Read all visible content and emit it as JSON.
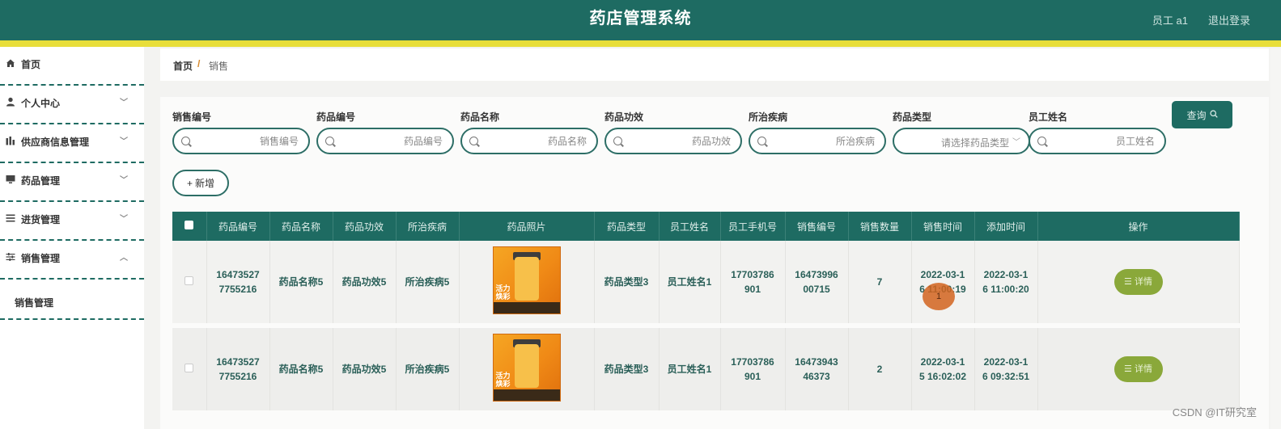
{
  "header": {
    "title": "药店管理系统",
    "user": "员工 a1",
    "logout": "退出登录"
  },
  "sidebar": {
    "items": [
      {
        "label": "首页",
        "icon": "home-icon"
      },
      {
        "label": "个人中心",
        "icon": "user-icon"
      },
      {
        "label": "供应商信息管理",
        "icon": "chart-icon"
      },
      {
        "label": "药品管理",
        "icon": "monitor-icon"
      },
      {
        "label": "进货管理",
        "icon": "list-icon"
      },
      {
        "label": "销售管理",
        "icon": "sliders-icon"
      }
    ],
    "sub_item": "销售管理"
  },
  "breadcrumb": {
    "home": "首页",
    "separator": "/",
    "current": "销售"
  },
  "search": {
    "fields": [
      {
        "label": "销售编号",
        "placeholder": "销售编号"
      },
      {
        "label": "药品编号",
        "placeholder": "药品编号"
      },
      {
        "label": "药品名称",
        "placeholder": "药品名称"
      },
      {
        "label": "药品功效",
        "placeholder": "药品功效"
      },
      {
        "label": "所治疾病",
        "placeholder": "所治疾病"
      },
      {
        "label": "药品类型",
        "placeholder": "请选择药品类型"
      },
      {
        "label": "员工姓名",
        "placeholder": "员工姓名"
      }
    ],
    "query_button": "查询",
    "add_button": "新增"
  },
  "table": {
    "headers": [
      "药品编号",
      "药品名称",
      "药品功效",
      "所治疾病",
      "药品照片",
      "药品类型",
      "员工姓名",
      "员工手机号",
      "销售编号",
      "销售数量",
      "销售时间",
      "添加时间",
      "操作"
    ],
    "rows": [
      {
        "drug_no": "16473527\n7755216",
        "drug_name": "药品名称5",
        "effect": "药品功效5",
        "disease": "所治疾病5",
        "photo_text": "活力\n焕彩",
        "type": "药品类型3",
        "staff": "员工姓名1",
        "phone": "17703786\n901",
        "sale_no": "16473996\n00715",
        "qty": "7",
        "sale_time": "2022-03-1\n6 11:00:19",
        "add_time": "2022-03-1\n6 11:00:20",
        "action": "详情"
      },
      {
        "drug_no": "16473527\n7755216",
        "drug_name": "药品名称5",
        "effect": "药品功效5",
        "disease": "所治疾病5",
        "photo_text": "活力\n焕彩",
        "type": "药品类型3",
        "staff": "员工姓名1",
        "phone": "17703786\n901",
        "sale_no": "16473943\n46373",
        "qty": "2",
        "sale_time": "2022-03-1\n5 16:02:02",
        "add_time": "2022-03-1\n6 09:32:51",
        "action": "详情"
      }
    ]
  },
  "cursor_label": "1",
  "watermark": "CSDN @IT研究室",
  "colors": {
    "primary": "#1e6b62",
    "accent_yellow": "#e8de3a",
    "detail_button": "#8aa83a"
  }
}
